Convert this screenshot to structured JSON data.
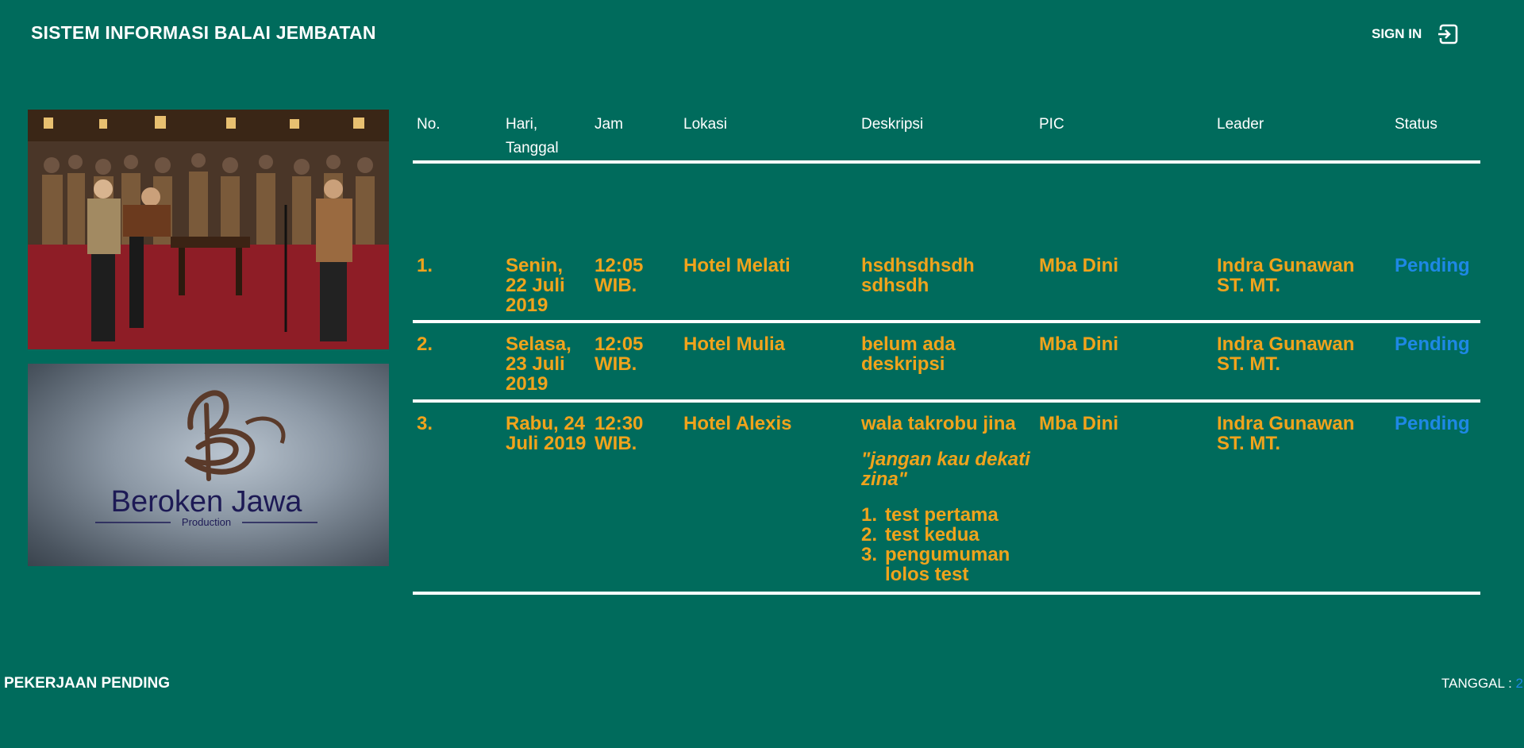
{
  "header": {
    "title": "SISTEM INFORMASI BALAI JEMBATAN",
    "signin_label": "SIGN IN",
    "signin_icon": "sign-in-icon"
  },
  "side_images": {
    "logo_text": "Beroken Jawa",
    "logo_subtext": "Production"
  },
  "table": {
    "headers": {
      "no": "No.",
      "hari_tanggal": "Hari, Tanggal",
      "jam": "Jam",
      "lokasi": "Lokasi",
      "deskripsi": "Deskripsi",
      "pic": "PIC",
      "leader": "Leader",
      "status": "Status"
    },
    "rows": [
      {
        "no": "1.",
        "hari_tanggal": "Senin, 22 Juli 2019",
        "jam": "12:05 WIB.",
        "lokasi": "Hotel Melati",
        "deskripsi": "hsdhsdhsdh sdhsdh",
        "pic": "Mba Dini",
        "leader": "Indra Gunawan ST. MT.",
        "status": "Pending"
      },
      {
        "no": "2.",
        "hari_tanggal": "Selasa, 23 Juli 2019",
        "jam": "12:05 WIB.",
        "lokasi": "Hotel Mulia",
        "deskripsi": "belum ada deskripsi",
        "pic": "Mba Dini",
        "leader": "Indra Gunawan ST. MT.",
        "status": "Pending"
      },
      {
        "no": "3.",
        "hari_tanggal": "Rabu, 24 Juli 2019",
        "jam": "12:30 WIB.",
        "lokasi": "Hotel Alexis",
        "deskripsi_title": "wala takrobu jina",
        "deskripsi_quote": "\"jangan kau dekati zina\"",
        "deskripsi_list": [
          {
            "num": "1.",
            "text": "test pertama"
          },
          {
            "num": "2.",
            "text": "test kedua"
          },
          {
            "num": "3.",
            "text": "pengumuman lolos test"
          }
        ],
        "pic": "Mba Dini",
        "leader": "Indra Gunawan ST. MT.",
        "status": "Pending"
      }
    ]
  },
  "footer": {
    "left_label": "PEKERJAAN PENDING",
    "date_label": "TANGGAL : ",
    "date_value": "2"
  },
  "colors": {
    "background": "#006b5c",
    "accent_orange": "#f0a31c",
    "status_blue": "#1e88e5"
  }
}
